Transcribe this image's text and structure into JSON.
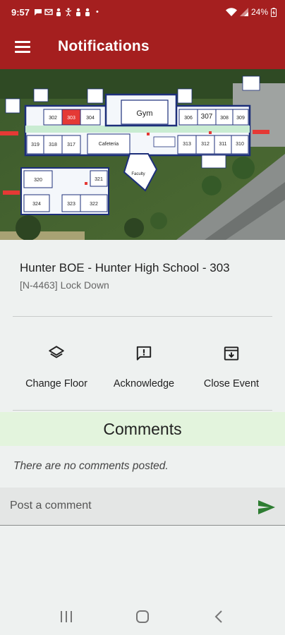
{
  "status_bar": {
    "time": "9:57",
    "battery": "24%",
    "notif_icons": [
      "chat-bubble-icon",
      "mail-icon",
      "person-icon",
      "accessibility-icon",
      "person-icon",
      "person-icon"
    ],
    "dot": "•"
  },
  "app_bar": {
    "title": "Notifications"
  },
  "map": {
    "gym_label": "Gym",
    "cafeteria_label": "Cafeteria",
    "faculty_label": "Faculty",
    "rooms_top": [
      "302",
      "303",
      "304",
      "306",
      "307",
      "308",
      "309"
    ],
    "rooms_mid": [
      "319",
      "318",
      "317",
      "313",
      "312",
      "311",
      "310"
    ],
    "rooms_low": [
      "320",
      "321",
      "324",
      "323",
      "322"
    ],
    "highlight_room": "303"
  },
  "notification": {
    "school": "Hunter BOE - Hunter High School - 303",
    "event": "[N-4463] Lock Down"
  },
  "actions": {
    "change_floor": "Change Floor",
    "acknowledge": "Acknowledge",
    "close_event": "Close Event"
  },
  "comments": {
    "header": "Comments",
    "empty_text": "There are no comments posted.",
    "placeholder": "Post a comment"
  },
  "colors": {
    "brand": "#a51f1f",
    "send": "#2e7d32",
    "comments_bg": "#e3f4dd"
  }
}
